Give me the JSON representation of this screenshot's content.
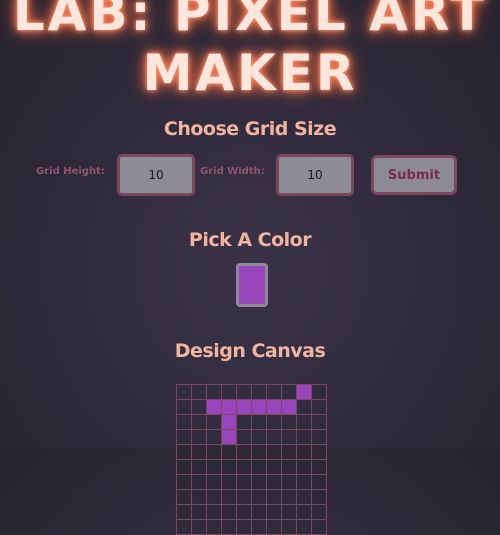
{
  "page": {
    "title_line1": "LAB: PIXEL ART",
    "title_line2": "MAKER"
  },
  "grid_size": {
    "heading": "Choose Grid Size",
    "height_label": "Grid Height:",
    "height_value": "10",
    "width_label": "Grid Width:",
    "width_value": "10",
    "submit_label": "Submit"
  },
  "color_picker": {
    "heading": "Pick A Color",
    "value": "#9646b8"
  },
  "canvas": {
    "heading": "Design Canvas",
    "rows": 10,
    "cols": 10,
    "painted_color": "#9646b8",
    "painted_cells": [
      [
        0,
        8
      ],
      [
        1,
        2
      ],
      [
        1,
        3
      ],
      [
        1,
        4
      ],
      [
        1,
        5
      ],
      [
        1,
        6
      ],
      [
        1,
        7
      ],
      [
        2,
        3
      ],
      [
        3,
        3
      ]
    ]
  }
}
